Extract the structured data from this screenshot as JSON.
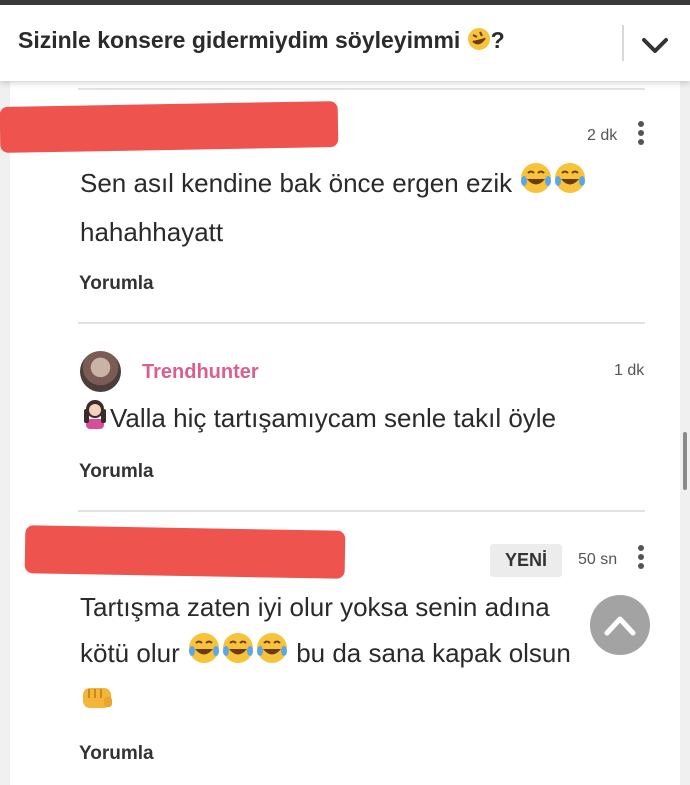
{
  "header": {
    "title": "Sizinle konsere gidermiydim söyleyimmi",
    "title_suffix": "?",
    "title_emoji": "rolling-on-floor-laughing-emoji"
  },
  "comments": [
    {
      "author": "",
      "time": "2 dk",
      "text_line1": "Sen asıl kendine bak önce ergen ezik",
      "text_line2": "hahahhayatt",
      "reply_label": "Yorumla"
    },
    {
      "author": "Trendhunter",
      "time": "1 dk",
      "text": "Valla hiç tartışamıycam senle takıl öyle",
      "reply_label": "Yorumla"
    },
    {
      "author": "",
      "badge": "YENİ",
      "time": "50 sn",
      "text_line1": "Tartışma zaten iyi olur yoksa senin adına",
      "text_line2_a": "kötü olur",
      "text_line2_b": "bu da sana kapak olsun",
      "reply_label": "Yorumla"
    }
  ],
  "colors": {
    "username": "#d9608e",
    "redaction": "#ee4a44",
    "fab": "#9a9a9a"
  }
}
